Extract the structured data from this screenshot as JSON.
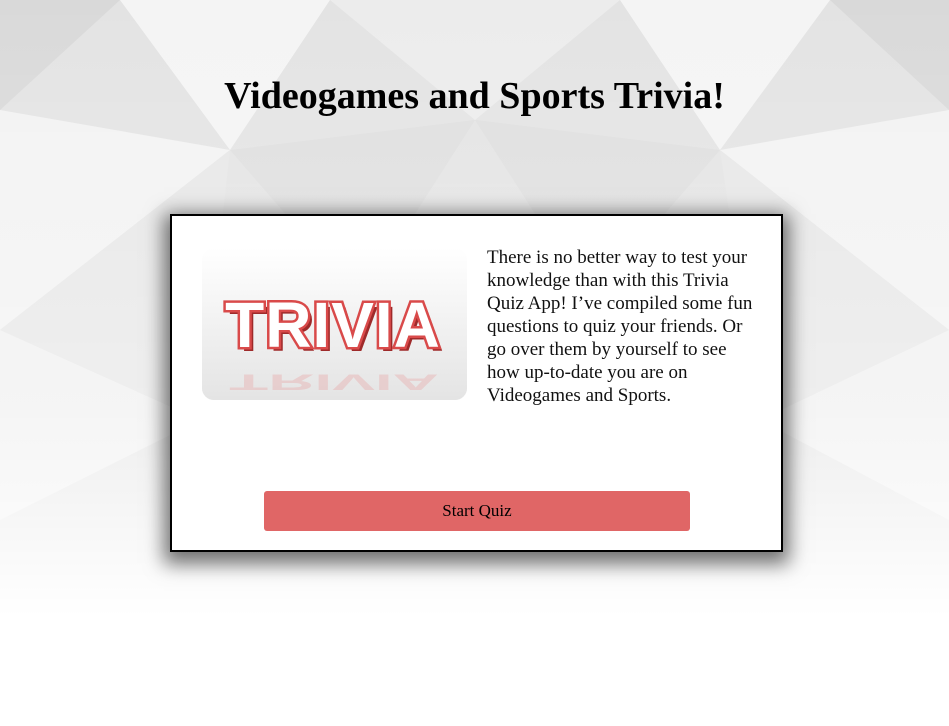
{
  "header": {
    "title": "Videogames and Sports Trivia!"
  },
  "card": {
    "image_text": "TRIVIA",
    "description": "There is no better way to test your knowledge than with this Trivia Quiz App! I’ve compiled some fun questions to quiz your friends. Or go over them by yourself to see how up-to-date you are on Videogames and Sports.",
    "start_button_label": "Start Quiz"
  },
  "colors": {
    "button": "#e06666",
    "trivia_letters": "#d94a4a",
    "card_border": "#000000"
  }
}
